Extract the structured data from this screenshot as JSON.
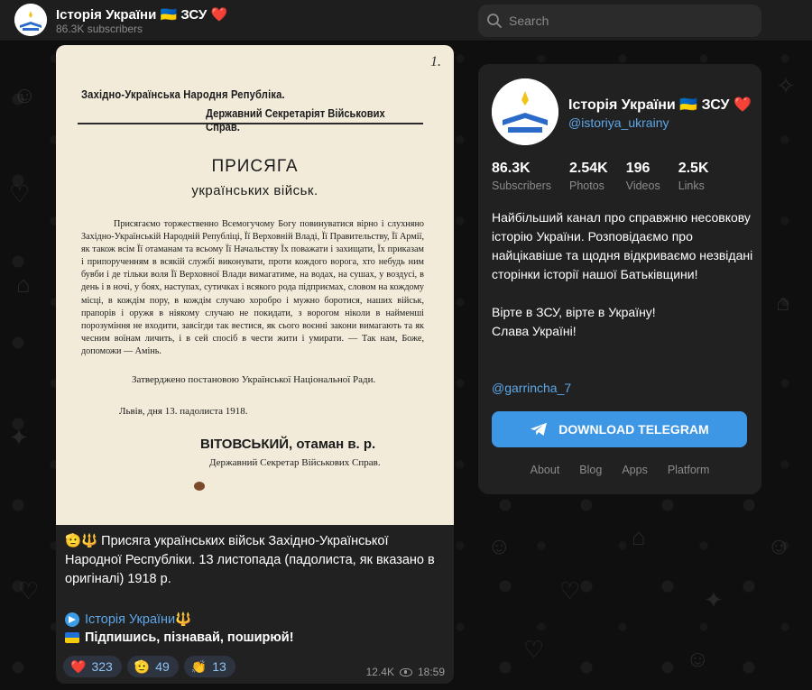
{
  "header": {
    "title": "Історія України 🇺🇦 ЗСУ ❤️",
    "subscribers": "86.3K subscribers",
    "search_placeholder": "Search"
  },
  "post": {
    "image": {
      "page_number": "1.",
      "header_line1": "Західно-Українська Народня Републіка.",
      "header_line2": "Державний Секретаріят Військових Справ.",
      "title": "ПРИСЯГА",
      "subtitle": "українських військ.",
      "body": "Присягаємо торжественно Всемогучому Богу повинуватися вірно і слухняно Західно-Українській Народній Републіці, Її Верховній Владі, Її Правительству, Її Армії, як також всім Її отаманам та всьому Її Начальству Їх поважати і захищати, Їх приказам і припорученням в всякій службі виконувати, проти кождого ворога, хто небудь ним бувби і де тільки воля Її Верховної Влади вимагатиме, на водах, на сушах, у воздусі, в день і в ночі, у боях, наступах, сутичках і всякого рода підприємах, словом на кождому місці, в кождім пору, в кождім случаю хоробро і мужно боротися, наших військ, прапорів і оружя в ніякому случаю не покидати, з ворогом ніколи в найменші порозуміння не входити, завсігди так вестися, як сього воєнні закони вимагають та як чесним воїнам личить, і в сей спосіб в чести жити і умирати. — Так нам, Боже, допоможи — Амінь.",
      "approved": "Затверджено постановою Української Національної Ради.",
      "date": "Львів, дня 13. падолиста 1918.",
      "signature": "ВІТОВСЬКИЙ, отаман в. р.",
      "signature_role": "Державний Секретар Військових Справ."
    },
    "caption_emoji": "🫡🔱",
    "caption": "Присяга українських військ Західно-Української Народної Республіки. 13 листопада (падолиста, як вказано в оригіналі) 1918 р.",
    "channel_link": "Історія України🔱",
    "subscribe_text": "Підпишись, пізнавай, поширюй!",
    "reactions": [
      {
        "emoji": "❤️",
        "count": "323"
      },
      {
        "emoji": "🫡",
        "count": "49"
      },
      {
        "emoji": "👏",
        "count": "13"
      }
    ],
    "views": "12.4K",
    "time": "18:59"
  },
  "profile": {
    "name": "Історія України 🇺🇦 ЗСУ ❤️",
    "handle": "@istoriya_ukrainy",
    "stats": [
      {
        "value": "86.3K",
        "label": "Subscribers"
      },
      {
        "value": "2.54K",
        "label": "Photos"
      },
      {
        "value": "196",
        "label": "Videos"
      },
      {
        "value": "2.5K",
        "label": "Links"
      }
    ],
    "description_p1": "Найбільший канал про справжню несовкову історію України. Розповідаємо про найцікавіше та щодня відкриваємо незвідані сторінки історії нашої Батьківщини!",
    "description_p2a": "Вірте в ЗСУ, вірте в Україну!",
    "description_p2b": "Слава Україні!",
    "mention": "@garrincha_7",
    "download_label": "DOWNLOAD TELEGRAM",
    "footer_links": [
      "About",
      "Blog",
      "Apps",
      "Platform"
    ]
  },
  "colors": {
    "accent": "#3d97e4",
    "link": "#5ea7e8",
    "card": "#212121",
    "header": "#1e1e1e"
  }
}
